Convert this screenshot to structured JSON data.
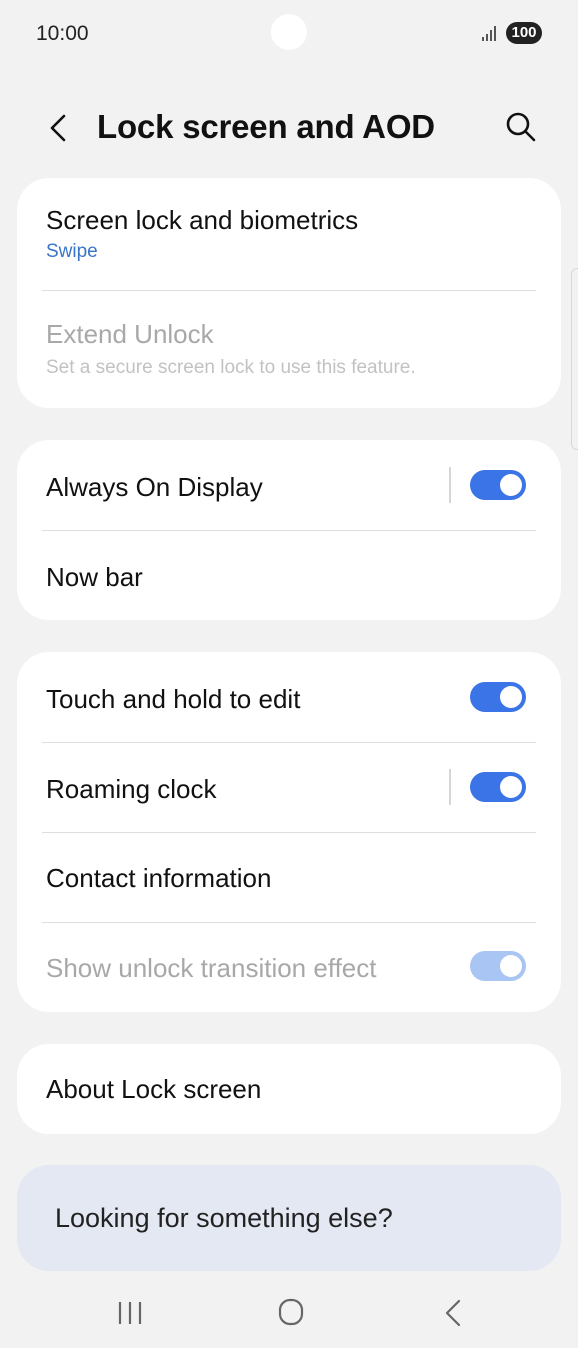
{
  "status_bar": {
    "time": "10:00",
    "battery": "100"
  },
  "header": {
    "title": "Lock screen and AOD"
  },
  "card1": {
    "screen_lock": {
      "title": "Screen lock and biometrics",
      "value": "Swipe"
    },
    "extend_unlock": {
      "title": "Extend Unlock",
      "subtitle": "Set a secure screen lock to use this feature."
    }
  },
  "card2": {
    "aod": {
      "title": "Always On Display",
      "enabled": true
    },
    "now_bar": {
      "title": "Now bar"
    }
  },
  "card3": {
    "touch_hold": {
      "title": "Touch and hold to edit",
      "enabled": true
    },
    "roaming_clock": {
      "title": "Roaming clock",
      "enabled": true
    },
    "contact_info": {
      "title": "Contact information"
    },
    "unlock_effect": {
      "title": "Show unlock transition effect",
      "enabled": true,
      "disabled": true
    }
  },
  "card4": {
    "about": {
      "title": "About Lock screen"
    }
  },
  "looking": {
    "text": "Looking for something else?"
  },
  "colors": {
    "accent": "#3a74e6",
    "link": "#3a74c9",
    "background": "#f2f2f2"
  }
}
